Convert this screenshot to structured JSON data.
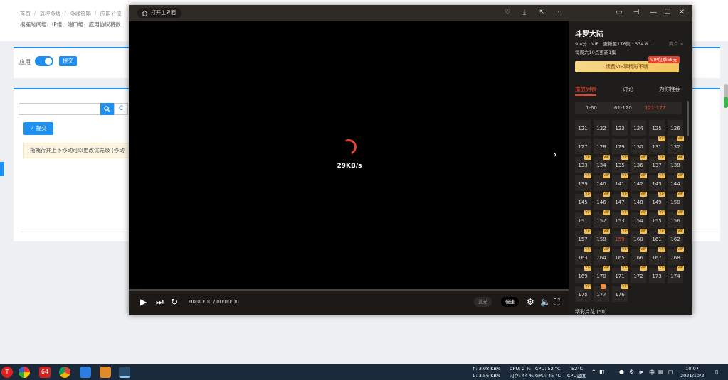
{
  "background": {
    "breadcrumb": [
      "首页",
      "流控多线",
      "多线策略",
      "应用分流"
    ],
    "description": "根据时间组、IP组、端口组、应用协议将数",
    "app_label": "应用",
    "submit_small": "提交",
    "submit_button": "✓ 提交",
    "reset_icon": "C",
    "alert_text": "拖拽行并上下移动可以更改优先级 (移动"
  },
  "player": {
    "home_button": "打开主界面",
    "loading_speed": "29KB/s",
    "time_display": "00:00:00 / 00:00:00",
    "quality_label": "蓝光",
    "speed_label": "倍速",
    "titlebar_icons": [
      "heart-add-icon",
      "download-icon",
      "share-icon",
      "more-icon",
      "mini-mode-icon",
      "pin-icon",
      "minimize-icon",
      "maximize-icon",
      "close-icon"
    ],
    "controls": [
      "play-icon",
      "next-episode-icon",
      "loop-icon",
      "settings-icon",
      "volume-icon",
      "fullscreen-icon"
    ]
  },
  "sidebar": {
    "title": "斗罗大陆",
    "meta": "9.4分 · VIP · 更新至176集 · 334.8...",
    "more": "简介 >",
    "update_schedule": "每周六10点更新1集",
    "vip_tag": "VIP包季58元",
    "vip_banner": "续费VIP享精彩不断",
    "tabs": [
      {
        "label": "播放列表",
        "active": true
      },
      {
        "label": "讨论",
        "active": false
      },
      {
        "label": "为你推荐",
        "active": false
      }
    ],
    "ranges": [
      {
        "label": "1-60",
        "active": false
      },
      {
        "label": "61-120",
        "active": false
      },
      {
        "label": "121-177",
        "active": true
      }
    ],
    "episodes": [
      {
        "n": "121"
      },
      {
        "n": "122"
      },
      {
        "n": "123"
      },
      {
        "n": "124"
      },
      {
        "n": "125"
      },
      {
        "n": "126"
      },
      {
        "n": "127"
      },
      {
        "n": "128"
      },
      {
        "n": "129"
      },
      {
        "n": "130"
      },
      {
        "n": "131",
        "vip": true
      },
      {
        "n": "132",
        "vip": true
      },
      {
        "n": "133",
        "vip": true
      },
      {
        "n": "134",
        "vip": true
      },
      {
        "n": "135",
        "vip": true
      },
      {
        "n": "136",
        "vip": true
      },
      {
        "n": "137",
        "vip": true
      },
      {
        "n": "138",
        "vip": true
      },
      {
        "n": "139",
        "vip": true
      },
      {
        "n": "140",
        "vip": true
      },
      {
        "n": "141",
        "vip": true
      },
      {
        "n": "142",
        "vip": true
      },
      {
        "n": "143",
        "vip": true
      },
      {
        "n": "144",
        "vip": true
      },
      {
        "n": "145",
        "vip": true
      },
      {
        "n": "146",
        "vip": true
      },
      {
        "n": "147",
        "vip": true
      },
      {
        "n": "148",
        "vip": true
      },
      {
        "n": "149",
        "vip": true
      },
      {
        "n": "150",
        "vip": true
      },
      {
        "n": "151",
        "vip": true
      },
      {
        "n": "152",
        "vip": true
      },
      {
        "n": "153",
        "vip": true
      },
      {
        "n": "154",
        "vip": true
      },
      {
        "n": "155",
        "vip": true
      },
      {
        "n": "156",
        "vip": true
      },
      {
        "n": "157",
        "vip": true
      },
      {
        "n": "158",
        "vip": true
      },
      {
        "n": "159",
        "vip": true,
        "current": true
      },
      {
        "n": "160",
        "vip": true
      },
      {
        "n": "161",
        "vip": true
      },
      {
        "n": "162",
        "vip": true
      },
      {
        "n": "163",
        "vip": true
      },
      {
        "n": "164",
        "vip": true
      },
      {
        "n": "165",
        "vip": true
      },
      {
        "n": "166",
        "vip": true
      },
      {
        "n": "167",
        "vip": true
      },
      {
        "n": "168",
        "vip": true
      },
      {
        "n": "169",
        "vip": true
      },
      {
        "n": "170",
        "vip": true
      },
      {
        "n": "171",
        "vip": true
      },
      {
        "n": "172",
        "vip": true
      },
      {
        "n": "173",
        "vip": true
      },
      {
        "n": "174",
        "vip": true
      },
      {
        "n": "175",
        "vip": true
      },
      {
        "n": "177",
        "tag": true
      },
      {
        "n": "176",
        "vip": true
      }
    ],
    "vip_badge": "VIP",
    "bottom_label": "精彩片花 (50)"
  },
  "taskbar": {
    "apps": [
      "T",
      "64"
    ],
    "net_up": "↑: 3.08 KB/s",
    "net_down": "↓: 3.56 KB/s",
    "cpu": "CPU: 2 %",
    "mem": "内存: 44 %",
    "cpu_temp": "CPU: 52 °C",
    "gpu_temp": "GPU: 45 °C",
    "temp_top": "52°C",
    "temp_label": "CPU温度",
    "ime": "中",
    "time": "10:07",
    "date": "2021/10/2"
  }
}
